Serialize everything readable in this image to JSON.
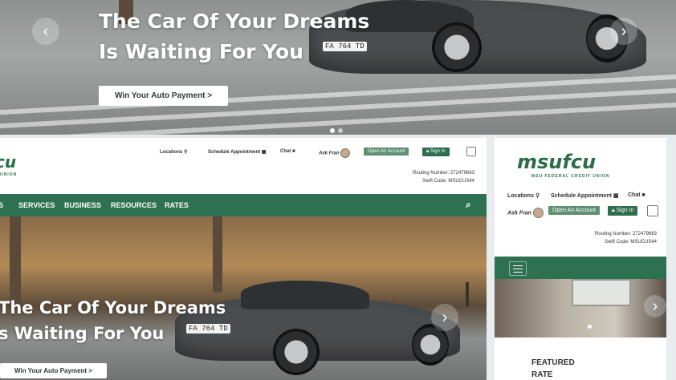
{
  "hero": {
    "title_line1": "The Car Of Your Dreams",
    "title_line2": "Is Waiting For You",
    "cta": "Win Your Auto Payment >",
    "plate": "FA 764 TD"
  },
  "desktop": {
    "cropped_title_line1": "The Car Of Your Dreams",
    "cropped_title_line2": "s Waiting For You",
    "logo_fragment": "cu",
    "logo_sub_fragment": "UNION",
    "util": {
      "locations": "Locations",
      "schedule": "Schedule Appointment",
      "chat": "Chat",
      "ask": "Ask Fran",
      "open_account": "Open An Account",
      "sign_in": "Sign In"
    },
    "routing": "Routing Number: 272479663",
    "swift": "Swift Code: MSUCUS44",
    "nav": [
      "S",
      "SERVICES",
      "BUSINESS",
      "RESOURCES",
      "RATES"
    ]
  },
  "mobile": {
    "logo": "msufcu",
    "logo_sub": "MSU FEDERAL CREDIT UNION",
    "locations": "Locations",
    "schedule": "Schedule Appointment",
    "chat": "Chat",
    "ask": "Ask Fran",
    "open_account": "Open An Account",
    "sign_in": "Sign In",
    "routing": "Routing Number: 272479663",
    "swift": "Swift Code: MSUCUS44",
    "featured": "FEATURED",
    "rate": "RATE"
  },
  "colors": {
    "brand_green": "#2e7150",
    "hero_button_text": "#2f3a33"
  },
  "icons": [
    "map-pin-icon",
    "calendar-icon",
    "chat-bubble-icon",
    "lock-icon",
    "search-icon",
    "hamburger-icon",
    "arrow-left-icon",
    "arrow-right-icon",
    "calendar-box-icon"
  ]
}
